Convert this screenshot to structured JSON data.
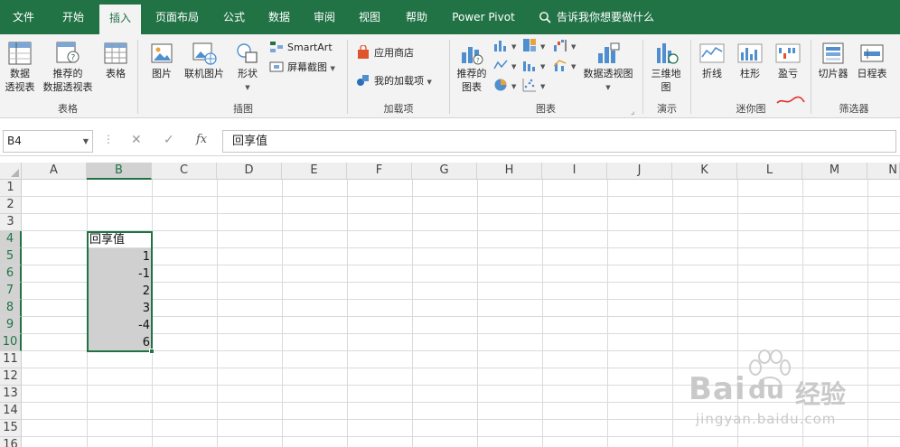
{
  "tabs": [
    {
      "label": "文件",
      "active": false
    },
    {
      "label": "开始",
      "active": false
    },
    {
      "label": "插入",
      "active": true
    },
    {
      "label": "页面布局",
      "active": false
    },
    {
      "label": "公式",
      "active": false
    },
    {
      "label": "数据",
      "active": false
    },
    {
      "label": "审阅",
      "active": false
    },
    {
      "label": "视图",
      "active": false
    },
    {
      "label": "帮助",
      "active": false
    },
    {
      "label": "Power Pivot",
      "active": false
    }
  ],
  "tell_me": "告诉我你想要做什么",
  "ribbon": {
    "groups": {
      "tables": "表格",
      "illustrations": "插图",
      "addins": "加载项",
      "charts": "图表",
      "tours": "演示",
      "sparklines": "迷你图",
      "filters": "筛选器"
    },
    "buttons": {
      "pivot_l1": "数据",
      "pivot_l2": "透视表",
      "rec_pivot_l1": "推荐的",
      "rec_pivot_l2": "数据透视表",
      "table": "表格",
      "picture": "图片",
      "online_picture": "联机图片",
      "shapes": "形状",
      "smartart": "SmartArt",
      "screenshot": "屏幕截图",
      "store": "应用商店",
      "my_addins": "我的加载项",
      "rec_chart_l1": "推荐的",
      "rec_chart_l2": "图表",
      "pivot_chart": "数据透视图",
      "map3d_l1": "三维地",
      "map3d_l2": "图",
      "line": "折线",
      "column": "柱形",
      "winloss": "盈亏",
      "slicer": "切片器",
      "timeline": "日程表"
    }
  },
  "formula_bar": {
    "name_box": "B4",
    "fx": "fx",
    "value": "回享值"
  },
  "grid": {
    "columns": [
      "A",
      "B",
      "C",
      "D",
      "E",
      "F",
      "G",
      "H",
      "I",
      "J",
      "K",
      "L",
      "M",
      "N"
    ],
    "selected_column": "B",
    "rows": [
      "1",
      "2",
      "3",
      "4",
      "5",
      "6",
      "7",
      "8",
      "9",
      "10",
      "11",
      "12",
      "13",
      "14",
      "15",
      "16"
    ],
    "selected_rows": [
      "4",
      "5",
      "6",
      "7",
      "8",
      "9",
      "10"
    ],
    "cells": {
      "B4": "回享值",
      "B5": "1",
      "B6": "-1",
      "B7": "2",
      "B8": "3",
      "B9": "-4",
      "B10": "6"
    }
  },
  "watermark": {
    "brand": "Bai",
    "brand_cn": "经验",
    "url": "jingyan.baidu.com"
  },
  "colors": {
    "accent": "#217346",
    "selection_fill": "#d0d0d0",
    "annotation": "#e0322f"
  }
}
